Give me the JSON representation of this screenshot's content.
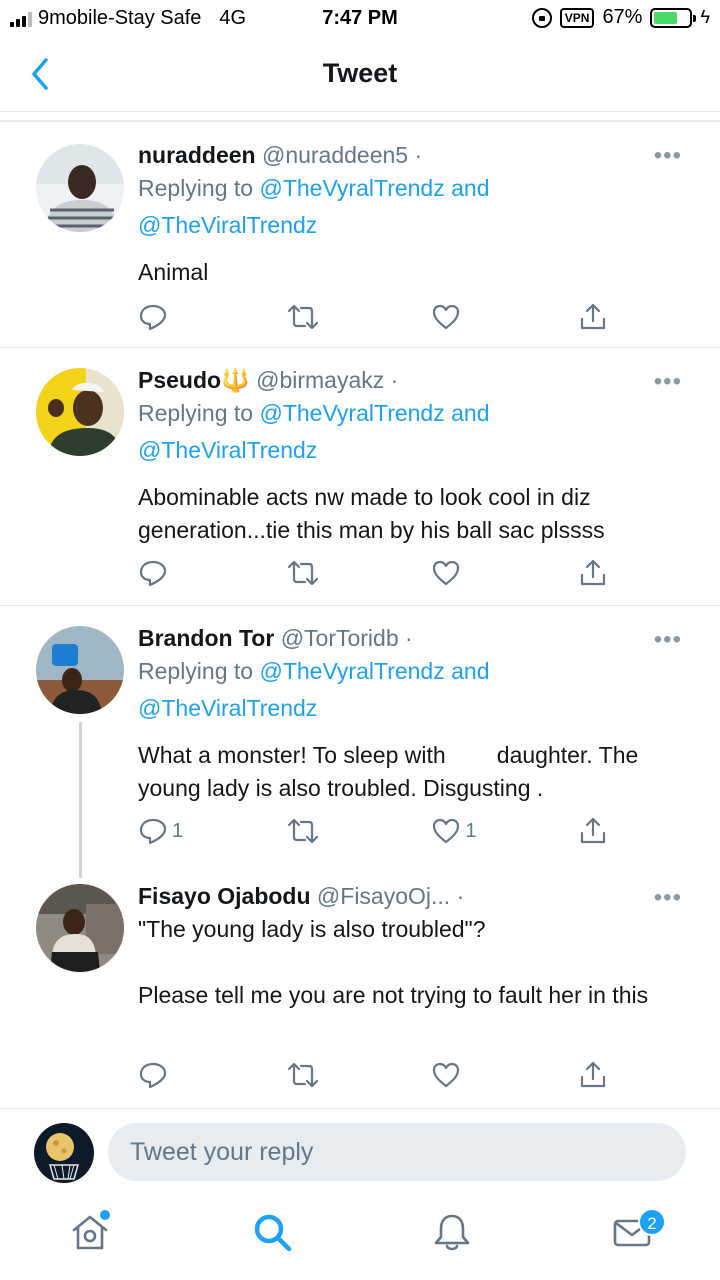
{
  "status_bar": {
    "carrier": "9mobile-Stay Safe",
    "network": "4G",
    "time": "7:47 PM",
    "vpn": "VPN",
    "battery": "67%",
    "battery_level": 0.67
  },
  "header": {
    "title": "Tweet",
    "back_icon": "chevron-left-icon"
  },
  "tweets": [
    {
      "name": "nuraddeen",
      "handle": "@nuraddeen5 ·",
      "replying_prefix": "Replying to",
      "reply_user1": "@TheVyralTrendz",
      "reply_and": "and",
      "reply_user2": "@TheViralTrendz",
      "text": "Animal",
      "more": "•••",
      "replies": "",
      "likes": ""
    },
    {
      "name": "Pseudo🔱",
      "handle": "@birmayakz ·",
      "replying_prefix": "Replying to",
      "reply_user1": "@TheVyralTrendz",
      "reply_and": "and",
      "reply_user2": "@TheViralTrendz",
      "text": "Abominable acts nw made to look cool in diz generation...tie this man by his ball sac plssss",
      "more": "•••",
      "replies": "",
      "likes": ""
    },
    {
      "name": "Brandon Tor",
      "handle": "@TorToridb ·",
      "replying_prefix": "Replying to",
      "reply_user1": "@TheVyralTrendz",
      "reply_and": "and",
      "reply_user2": "@TheViralTrendz",
      "text": "What a monster! To sleep with        daughter. The young lady is also troubled. Disgusting .",
      "more": "•••",
      "replies": "1",
      "likes": "1"
    },
    {
      "name": "Fisayo Ojabodu",
      "handle": "@FisayoOj... ·",
      "text_line1": "\"The young lady is also troubled\"?",
      "text_line2": "Please tell me you are not trying to fault her in this",
      "more": "•••",
      "replies": "",
      "likes": ""
    }
  ],
  "composer": {
    "placeholder": "Tweet your reply"
  },
  "tabbar": {
    "home_icon": "home-icon",
    "search_icon": "search-icon",
    "notifications_icon": "bell-icon",
    "messages_icon": "mail-icon",
    "messages_badge": "2"
  },
  "colors": {
    "accent": "#1da1f2",
    "muted": "#657786",
    "text": "#14171a"
  }
}
